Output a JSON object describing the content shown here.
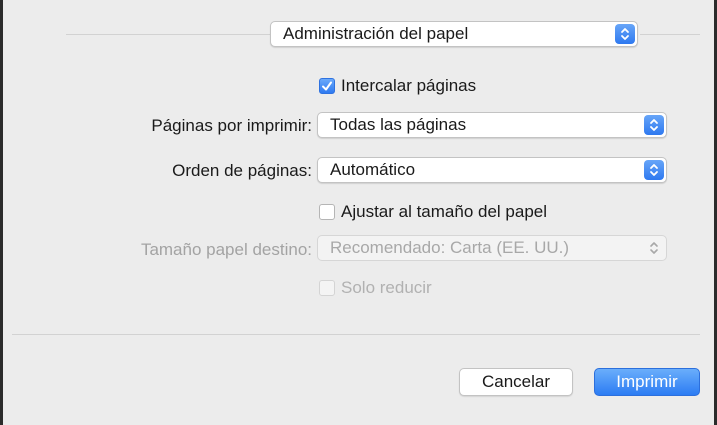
{
  "header": {
    "panel_select": "Administración del papel"
  },
  "options": {
    "collate_checkbox": {
      "label": "Intercalar páginas",
      "checked": true
    },
    "pages_to_print": {
      "label": "Páginas por imprimir:",
      "value": "Todas las páginas"
    },
    "page_order": {
      "label": "Orden de páginas:",
      "value": "Automático"
    },
    "scale_to_fit_checkbox": {
      "label": "Ajustar al tamaño del papel",
      "checked": false
    },
    "destination_paper_size": {
      "label": "Tamaño papel destino:",
      "value": "Recomendado: Carta (EE. UU.)",
      "enabled": false
    },
    "scale_down_only_checkbox": {
      "label": "Solo reducir",
      "checked": false,
      "enabled": false
    }
  },
  "footer": {
    "cancel_label": "Cancelar",
    "print_label": "Imprimir"
  },
  "colors": {
    "accent": "#2e79f0",
    "background": "#ececec"
  }
}
